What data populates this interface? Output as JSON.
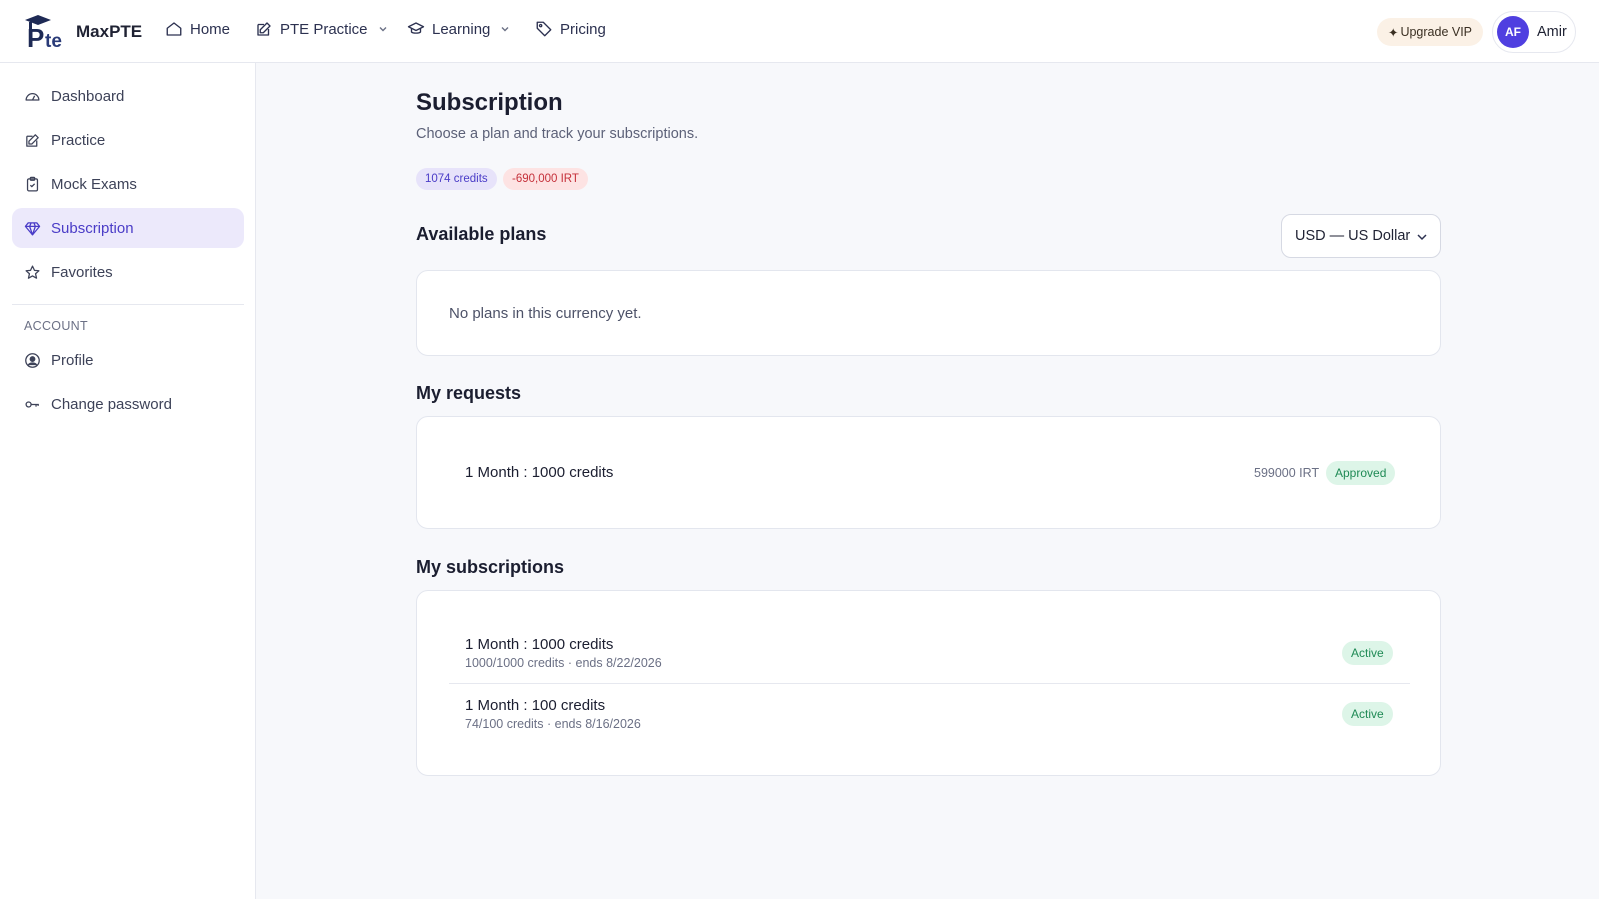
{
  "topbar": {
    "brand": "MaxPTE",
    "nav": [
      {
        "label": "Home",
        "icon": "home-icon"
      },
      {
        "label": "PTE Practice",
        "icon": "edit-icon"
      },
      {
        "label": "Learning",
        "icon": "graduation-cap-icon"
      },
      {
        "label": "Pricing",
        "icon": "tag-icon"
      }
    ],
    "upgrade_label": "Upgrade VIP",
    "upgrade_star": "✦",
    "user_initials": "AF",
    "user_name": "Amir"
  },
  "sidebar": {
    "items": [
      {
        "label": "Dashboard",
        "icon": "gauge-icon"
      },
      {
        "label": "Practice",
        "icon": "edit-icon"
      },
      {
        "label": "Mock Exams",
        "icon": "clipboard-icon"
      },
      {
        "label": "Subscription",
        "icon": "diamond-icon",
        "active": true
      },
      {
        "label": "Favorites",
        "icon": "star-icon"
      }
    ],
    "account_heading": "ACCOUNT",
    "account_items": [
      {
        "label": "Profile",
        "icon": "user-circle-icon"
      },
      {
        "label": "Change password",
        "icon": "key-icon"
      }
    ]
  },
  "main": {
    "title": "Subscription",
    "subtitle": "Choose a plan and track your subscriptions.",
    "credits_pill": "1074 credits",
    "balance_pill": "-690,000 IRT",
    "available_plans_title": "Available plans",
    "currency_selected": "USD — US Dollar",
    "empty_plans": "No plans in this currency yet.",
    "requests_title": "My requests",
    "requests": [
      {
        "title": "1 Month : 1000 credits",
        "price": "599000 IRT",
        "status": "Approved"
      }
    ],
    "subscriptions_title": "My subscriptions",
    "subscriptions": [
      {
        "title": "1 Month : 1000 credits",
        "meta": "1000/1000 credits · ends 8/22/2026",
        "status": "Active"
      },
      {
        "title": "1 Month : 100 credits",
        "meta": "74/100 credits · ends 8/16/2026",
        "status": "Active"
      }
    ]
  },
  "colors": {
    "accent": "#4f3fe0",
    "active_bg": "#ece9fb",
    "success": "#1f8a55",
    "danger": "#c5303a"
  }
}
